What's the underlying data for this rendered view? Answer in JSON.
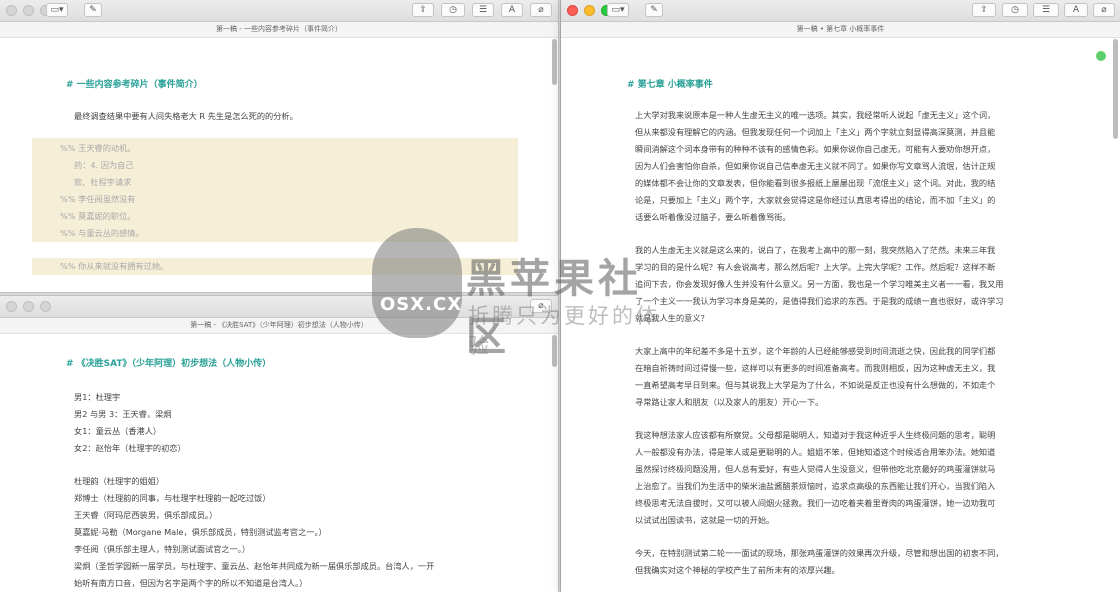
{
  "left_top": {
    "title": "第一稿 - 一些内容参考碎片（事件简介）",
    "heading": "# 一些内容参考碎片（事件简介）",
    "lines": [
      "最终调查结果中要有人间失格老大 R 先生是怎么死的的分析。",
      "%% 王天睿的动机。",
      "药：4. 因为自己",
      "款、杜程宇请求",
      "%% 李任阅虽然没有",
      "%% 莫嘉妮的职位。",
      "%% 与童云丛的感情。",
      "%% 你从来就没有拥有过她。"
    ]
  },
  "left_bottom": {
    "title": "第一稿 - 《决胜SAT》（少年阿理）初步想法（人物小传）",
    "heading": "# 《决胜SAT》（少年阿理）初步想法（人物小传）",
    "lines": [
      "男1：杜理宇",
      "男2 与男 3：王天睿，梁炯",
      "女1：童云丛（香港人）",
      "女2：赵怡年（杜理宇的初恋）",
      "杜理韵（杜理宇的姐姐）",
      "郑博士（杜理韵的同事，与杜理宇杜理韵一起吃过饭）",
      "王天睿（阿玛尼西装男，俱乐部成员。）",
      "莫嘉妮·马勒（Morgane Male，俱乐部成员，特别测试监考官之一。）",
      "李任阅（俱乐部主理人，特别测试面试官之一。）",
      "梁炯（圣哲学园新一届学员，与杜理宇、童云丛、赵怡年共同成为新一届俱乐部成员。台湾人，一开",
      "始听有南方口音，但因为名字是两个字的所以不知道是台湾人。）"
    ]
  },
  "right": {
    "title": "第一稿 • 第七章 小概率事件",
    "heading": "# 第七章 小概率事件",
    "lines": [
      "上大学对我来说原本是一种人生虚无主义的唯一选项。其实，我经常听人说起「虚无主义」这个词，",
      "但从来都没有理解它的内涵。但我发现任何一个词加上「主义」两个字就立刻显得高深莫测，并且能",
      "瞬间消解这个词本身带有的种种不该有的感情色彩。如果你说你自己虚无，可能有人要劝你想开点，",
      "因为人们会害怕你自杀，但如果你说自己信奉虚无主义就不同了。如果你写文章骂人流氓，估计正规",
      "的媒体都不会让你的文章发表，但你能看到很多报纸上屡屡出现「流氓主义」这个词。对此，我的结",
      "论是，只要加上「主义」两个字，大家就会觉得这是你经过认真思考得出的结论，而不加「主义」的",
      "话要么听着像没过脑子，要么听着像骂街。",
      "我的人生虚无主义就是这么来的，说白了，在我考上高中的那一刻，我突然陷入了茫然。未来三年我",
      "学习的目的是什么呢？有人会说高考，那么然后呢？上大学。上完大学呢？工作。然后呢？这样不断",
      "追问下去，你会发现好像人生并没有什么意义。另一方面，我也是一个学习唯美主义者一一看，我又用",
      "了一个主义一一我认为学习本身是美的，是值得我们追求的东西。于是我的成绩一直也很好，或许学习",
      "就是我人生的意义？",
      "大家上高中的年纪差不多是十五岁，这个年龄的人已经能够感受到时间流逝之快，因此我的同学们都",
      "在暗自祈祷时间过得慢一些，这样可以有更多的时间准备高考。而我则相反，因为这种虚无主义，我",
      "一直希望高考早日到来。但与其说我上大学是为了什么，不如说是反正也没有什么想做的，不如走个",
      "寻常路让家人和朋友（以及家人的朋友）开心一下。",
      "我这种想法家人应该都有所察觉。父母都是聪明人，知道对于我这种近乎人生终极问题的思考，聪明",
      "人一般都没有办法，得是笨人或是更聪明的人。姐姐不笨，但她知道这个时候适合用笨办法。她知道",
      "虽然探讨终极问题没用，但人总有爱好，有些人觉得人生没意义，但带他吃北京最好的鸡蛋灌饼就马",
      "上治愈了。当我们为生活中的柴米油盐酱醋茶烦恼时，追求点高级的东西能让我们开心，当我们陷入",
      "终极思考无法自拔时，又可以被人间烟火拯救。我们一边吃着夹着里脊肉的鸡蛋灌饼，她一边劝我可",
      "以试试出国读书，这就是一切的开始。",
      "今天，在特别测试第二轮一一面试的现场，那张鸡蛋灌饼的效果再次升级，尽管和想出国的初衷不同，",
      "但我确实对这个神秘的学校产生了前所未有的浓厚兴趣。"
    ]
  },
  "watermark": {
    "osx": "OSX.CX",
    "big": "黑苹果社区",
    "small": "折腾只为更好的体验"
  },
  "toolbar_icons": [
    "sidebar-icon",
    "compose-icon",
    "share-icon",
    "clock-icon",
    "list-icon",
    "font-icon",
    "attach-icon"
  ]
}
